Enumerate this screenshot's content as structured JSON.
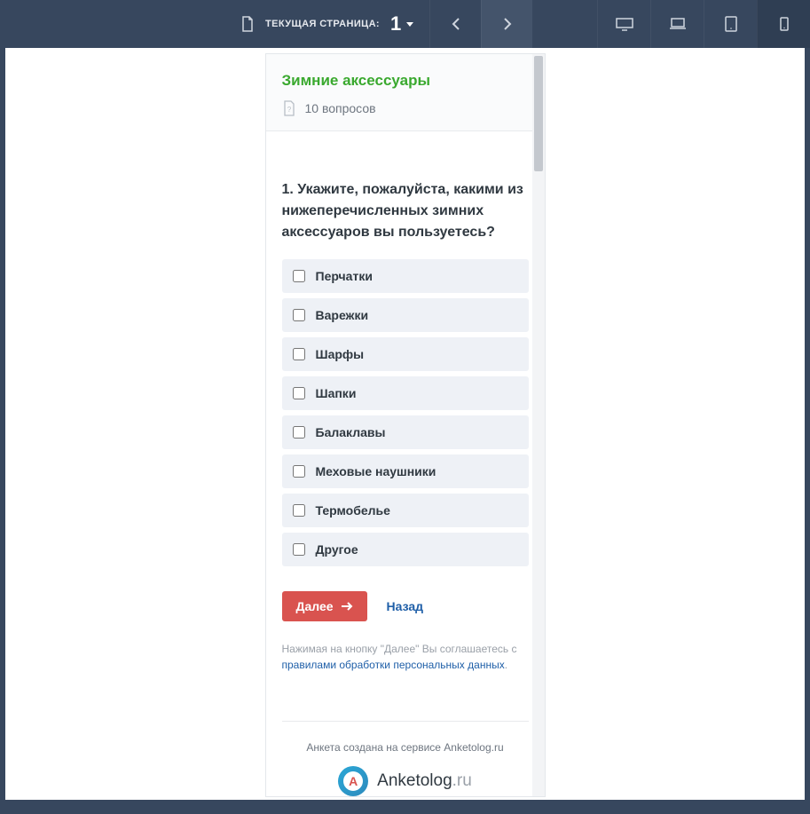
{
  "toolbar": {
    "page_label": "ТЕКУЩАЯ СТРАНИЦА:",
    "page_number": "1"
  },
  "survey": {
    "title": "Зимние аксессуары",
    "question_count": "10 вопросов",
    "question_text": "1. Укажите, пожалуйста, какими из нижеперечисленных зимних аксессуаров вы пользуетесь?",
    "options": [
      "Перчатки",
      "Варежки",
      "Шарфы",
      "Шапки",
      "Балаклавы",
      "Меховые наушники",
      "Термобелье",
      "Другое"
    ],
    "next_label": "Далее",
    "back_label": "Назад",
    "consent_prefix": "Нажимая на кнопку \"Далее\" Вы соглашаетесь с ",
    "consent_link": "правилами обработки персональных данных",
    "footer_text": "Анкета создана на сервисе Anketolog.ru",
    "logo_main": "Anketolog",
    "logo_suffix": ".ru"
  }
}
